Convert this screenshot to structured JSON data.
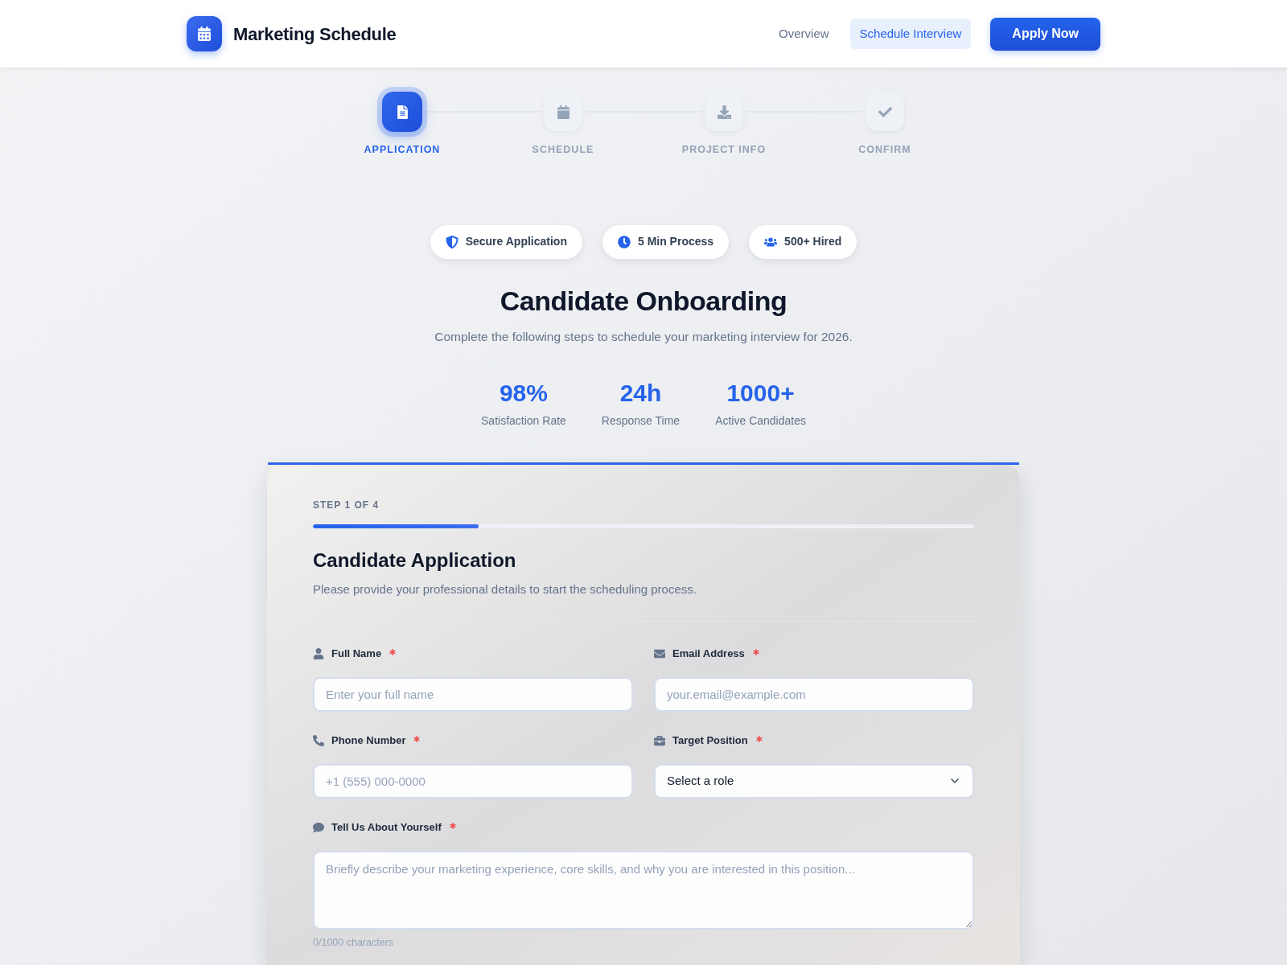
{
  "header": {
    "title": "Marketing Schedule",
    "nav": [
      {
        "label": "Overview",
        "selected": false
      },
      {
        "label": "Schedule Interview",
        "selected": true
      }
    ],
    "cta": "Apply Now"
  },
  "steps": [
    {
      "label": "APPLICATION",
      "selected": true
    },
    {
      "label": "SCHEDULE",
      "selected": false
    },
    {
      "label": "PROJECT INFO",
      "selected": false
    },
    {
      "label": "CONFIRM",
      "selected": false
    }
  ],
  "badges": [
    {
      "label": "Secure Application"
    },
    {
      "label": "5 Min Process"
    },
    {
      "label": "500+ Hired"
    }
  ],
  "hero": {
    "title": "Candidate Onboarding",
    "subtitle": "Complete the following steps to schedule your marketing interview for 2026."
  },
  "stats": [
    {
      "value": "98%",
      "label": "Satisfaction Rate"
    },
    {
      "value": "24h",
      "label": "Response Time"
    },
    {
      "value": "1000+",
      "label": "Active Candidates"
    }
  ],
  "form": {
    "step_label": "STEP 1 OF 4",
    "progress": {
      "level": 0.25
    },
    "title": "Candidate Application",
    "description": "Please provide your professional details to start the scheduling process.",
    "fields": [
      {
        "kind": "input",
        "label": "Full Name",
        "required": true,
        "placeholder": "Enter your full name"
      },
      {
        "kind": "input",
        "label": "Email Address",
        "required": true,
        "placeholder": "your.email@example.com"
      },
      {
        "kind": "input",
        "label": "Phone Number",
        "required": true,
        "placeholder": "+1 (555) 000-0000"
      },
      {
        "kind": "select",
        "label": "Target Position",
        "required": true,
        "value": "Select a role"
      },
      {
        "kind": "textarea",
        "label": "Tell Us About Yourself",
        "required": true,
        "placeholder": "Briefly describe your marketing experience, core skills, and why you are interested in this position..."
      }
    ],
    "char_count": "0/1000 characters"
  }
}
